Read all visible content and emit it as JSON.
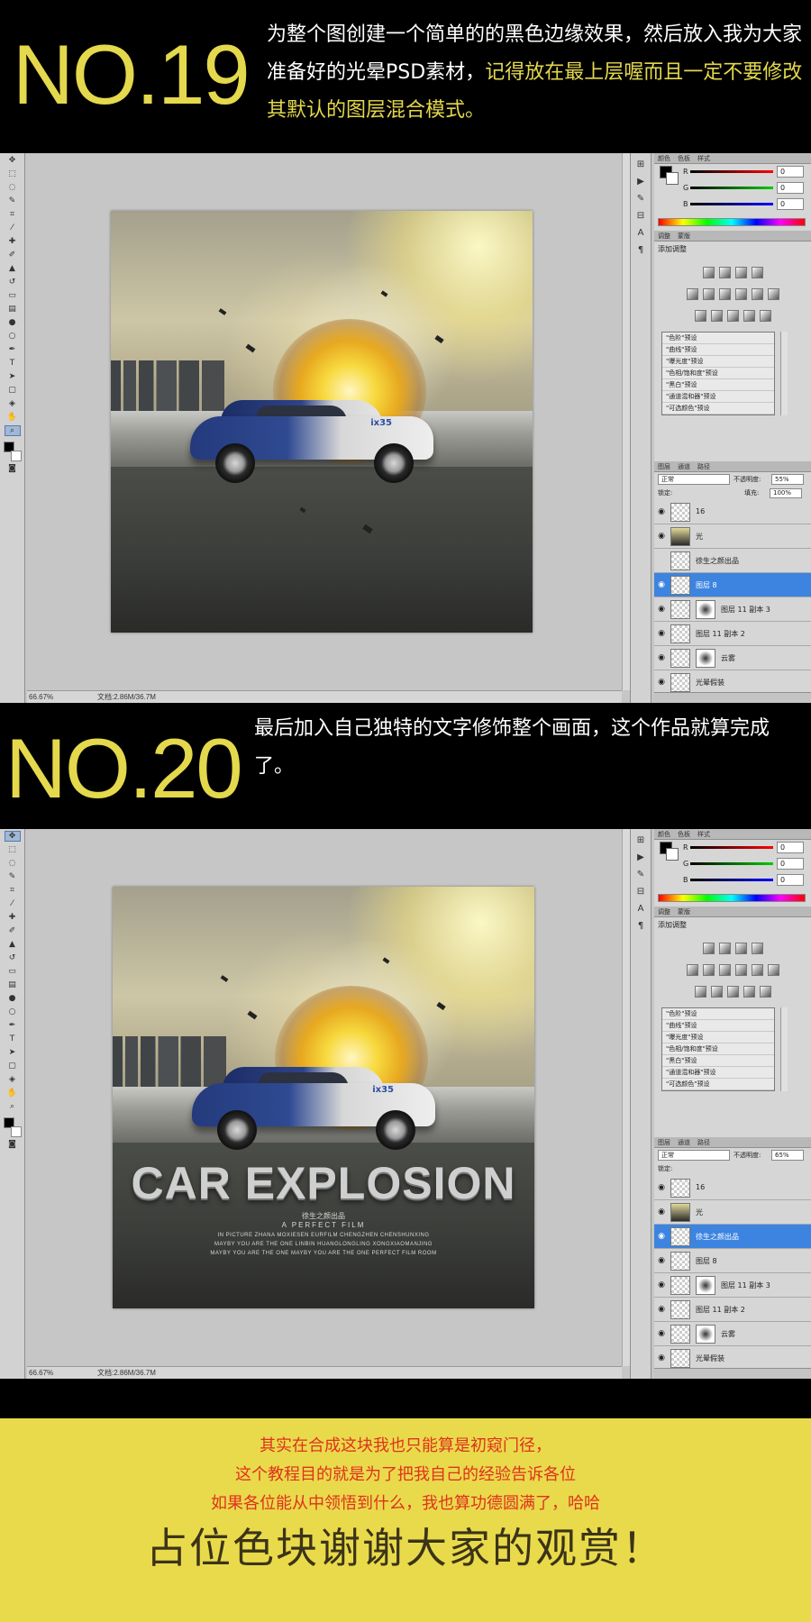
{
  "step19": {
    "number": "NO.19",
    "desc_normal": "为整个图创建一个简单的的黑色边缘效果，然后放入我为大家准备好的光晕PSD素材，",
    "desc_highlight": "记得放在最上层喔而且一定不要修改其默认的图层混合模式。"
  },
  "step20": {
    "number": "NO.20",
    "desc": "最后加入自己独特的文字修饰整个画面，这个作品就算完成了。"
  },
  "window1": {
    "zoom": "66.67%",
    "doc_info": "文档:2.86M/36.7M",
    "color_values": [
      "0",
      "0",
      "0"
    ],
    "adjust_title": "添加调整",
    "blend_mode": "正常",
    "opacity_label": "不透明度:",
    "opacity": "55%",
    "lock_label": "锁定:",
    "fill_label": "填充:",
    "fill": "100%",
    "layers": [
      {
        "name": "16",
        "visible": true,
        "selected": false,
        "mask": false
      },
      {
        "name": "光",
        "visible": true,
        "selected": false,
        "mask": false
      },
      {
        "name": "徐生之颜出品",
        "visible": false,
        "selected": false,
        "mask": false
      },
      {
        "name": "图层 8",
        "visible": true,
        "selected": true,
        "mask": false
      },
      {
        "name": "图层 11 副本 3",
        "visible": true,
        "selected": false,
        "mask": true
      },
      {
        "name": "图层 11 副本 2",
        "visible": true,
        "selected": false,
        "mask": false
      },
      {
        "name": "云雾",
        "visible": true,
        "selected": false,
        "mask": true
      },
      {
        "name": "光晕假装",
        "visible": true,
        "selected": false,
        "mask": false
      }
    ]
  },
  "window2": {
    "zoom": "66.67%",
    "doc_info": "文档:2.86M/36.7M",
    "color_values": [
      "0",
      "0",
      "0"
    ],
    "adjust_title": "添加调整",
    "blend_mode": "正常",
    "opacity_label": "不透明度:",
    "opacity": "65%",
    "lock_label": "锁定:",
    "layers": [
      {
        "name": "16",
        "visible": true,
        "selected": false,
        "mask": false
      },
      {
        "name": "光",
        "visible": true,
        "selected": false,
        "mask": false
      },
      {
        "name": "徐生之颜出品",
        "visible": true,
        "selected": true,
        "mask": false
      },
      {
        "name": "图层 8",
        "visible": true,
        "selected": false,
        "mask": false
      },
      {
        "name": "图层 11 副本 3",
        "visible": true,
        "selected": false,
        "mask": true
      },
      {
        "name": "图层 11 副本 2",
        "visible": true,
        "selected": false,
        "mask": false
      },
      {
        "name": "云雾",
        "visible": true,
        "selected": false,
        "mask": true
      },
      {
        "name": "光晕假装",
        "visible": true,
        "selected": false,
        "mask": false
      }
    ]
  },
  "panel_tabs": {
    "color_a": "颜色",
    "color_b": "色板",
    "color_c": "样式",
    "adjust_a": "调整",
    "adjust_b": "蒙版",
    "layers_a": "图层",
    "layers_b": "通道",
    "layers_c": "路径"
  },
  "channels": [
    "R",
    "G",
    "B"
  ],
  "presets": [
    "\"色阶\"预设",
    "\"曲线\"预设",
    "\"曝光度\"预设",
    "\"色相/饱和度\"预设",
    "\"黑白\"预设",
    "\"通道混和器\"预设",
    "\"可选颜色\"预设"
  ],
  "poster": {
    "car_tag": "ix35",
    "title": "CAR EXPLOSION",
    "sub1": "徐生之颜出品",
    "sub2": "A PERFECT FILM",
    "credit1": "IN PICTURE ZHANA MOXIESEN    EURFILM    CHENGZHEN CHENSHUNXING",
    "credit2": "MAYBY YOU ARE THE ONE    LINBIN HUANGLONGLING    XONGXIAOMANJING",
    "credit3": "MAYBY YOU ARE THE ONE    MAYBY YOU ARE THE ONE    PERFECT FILM ROOM"
  },
  "footer": {
    "line1": "其实在合成这块我也只能算是初窥门径，",
    "line2": "这个教程目的就是为了把我自己的经验告诉各位",
    "line3": "如果各位能从中领悟到什么，我也算功德圆满了，哈哈",
    "big": "占位色块谢谢大家的观赏！"
  },
  "colors": {
    "accent_yellow": "#e4d84c",
    "footer_bg": "#e9da4b",
    "footer_red": "#e0311d",
    "selection_blue": "#3c84e0"
  }
}
